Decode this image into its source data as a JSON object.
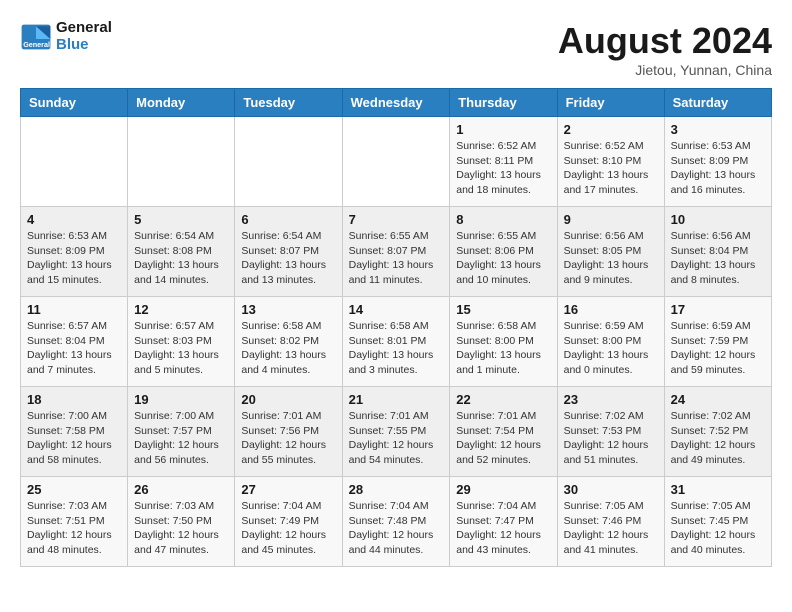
{
  "logo": {
    "line1": "General",
    "line2": "Blue"
  },
  "title": "August 2024",
  "subtitle": "Jietou, Yunnan, China",
  "weekdays": [
    "Sunday",
    "Monday",
    "Tuesday",
    "Wednesday",
    "Thursday",
    "Friday",
    "Saturday"
  ],
  "weeks": [
    [
      {
        "day": "",
        "info": ""
      },
      {
        "day": "",
        "info": ""
      },
      {
        "day": "",
        "info": ""
      },
      {
        "day": "",
        "info": ""
      },
      {
        "day": "1",
        "info": "Sunrise: 6:52 AM\nSunset: 8:11 PM\nDaylight: 13 hours\nand 18 minutes."
      },
      {
        "day": "2",
        "info": "Sunrise: 6:52 AM\nSunset: 8:10 PM\nDaylight: 13 hours\nand 17 minutes."
      },
      {
        "day": "3",
        "info": "Sunrise: 6:53 AM\nSunset: 8:09 PM\nDaylight: 13 hours\nand 16 minutes."
      }
    ],
    [
      {
        "day": "4",
        "info": "Sunrise: 6:53 AM\nSunset: 8:09 PM\nDaylight: 13 hours\nand 15 minutes."
      },
      {
        "day": "5",
        "info": "Sunrise: 6:54 AM\nSunset: 8:08 PM\nDaylight: 13 hours\nand 14 minutes."
      },
      {
        "day": "6",
        "info": "Sunrise: 6:54 AM\nSunset: 8:07 PM\nDaylight: 13 hours\nand 13 minutes."
      },
      {
        "day": "7",
        "info": "Sunrise: 6:55 AM\nSunset: 8:07 PM\nDaylight: 13 hours\nand 11 minutes."
      },
      {
        "day": "8",
        "info": "Sunrise: 6:55 AM\nSunset: 8:06 PM\nDaylight: 13 hours\nand 10 minutes."
      },
      {
        "day": "9",
        "info": "Sunrise: 6:56 AM\nSunset: 8:05 PM\nDaylight: 13 hours\nand 9 minutes."
      },
      {
        "day": "10",
        "info": "Sunrise: 6:56 AM\nSunset: 8:04 PM\nDaylight: 13 hours\nand 8 minutes."
      }
    ],
    [
      {
        "day": "11",
        "info": "Sunrise: 6:57 AM\nSunset: 8:04 PM\nDaylight: 13 hours\nand 7 minutes."
      },
      {
        "day": "12",
        "info": "Sunrise: 6:57 AM\nSunset: 8:03 PM\nDaylight: 13 hours\nand 5 minutes."
      },
      {
        "day": "13",
        "info": "Sunrise: 6:58 AM\nSunset: 8:02 PM\nDaylight: 13 hours\nand 4 minutes."
      },
      {
        "day": "14",
        "info": "Sunrise: 6:58 AM\nSunset: 8:01 PM\nDaylight: 13 hours\nand 3 minutes."
      },
      {
        "day": "15",
        "info": "Sunrise: 6:58 AM\nSunset: 8:00 PM\nDaylight: 13 hours\nand 1 minute."
      },
      {
        "day": "16",
        "info": "Sunrise: 6:59 AM\nSunset: 8:00 PM\nDaylight: 13 hours\nand 0 minutes."
      },
      {
        "day": "17",
        "info": "Sunrise: 6:59 AM\nSunset: 7:59 PM\nDaylight: 12 hours\nand 59 minutes."
      }
    ],
    [
      {
        "day": "18",
        "info": "Sunrise: 7:00 AM\nSunset: 7:58 PM\nDaylight: 12 hours\nand 58 minutes."
      },
      {
        "day": "19",
        "info": "Sunrise: 7:00 AM\nSunset: 7:57 PM\nDaylight: 12 hours\nand 56 minutes."
      },
      {
        "day": "20",
        "info": "Sunrise: 7:01 AM\nSunset: 7:56 PM\nDaylight: 12 hours\nand 55 minutes."
      },
      {
        "day": "21",
        "info": "Sunrise: 7:01 AM\nSunset: 7:55 PM\nDaylight: 12 hours\nand 54 minutes."
      },
      {
        "day": "22",
        "info": "Sunrise: 7:01 AM\nSunset: 7:54 PM\nDaylight: 12 hours\nand 52 minutes."
      },
      {
        "day": "23",
        "info": "Sunrise: 7:02 AM\nSunset: 7:53 PM\nDaylight: 12 hours\nand 51 minutes."
      },
      {
        "day": "24",
        "info": "Sunrise: 7:02 AM\nSunset: 7:52 PM\nDaylight: 12 hours\nand 49 minutes."
      }
    ],
    [
      {
        "day": "25",
        "info": "Sunrise: 7:03 AM\nSunset: 7:51 PM\nDaylight: 12 hours\nand 48 minutes."
      },
      {
        "day": "26",
        "info": "Sunrise: 7:03 AM\nSunset: 7:50 PM\nDaylight: 12 hours\nand 47 minutes."
      },
      {
        "day": "27",
        "info": "Sunrise: 7:04 AM\nSunset: 7:49 PM\nDaylight: 12 hours\nand 45 minutes."
      },
      {
        "day": "28",
        "info": "Sunrise: 7:04 AM\nSunset: 7:48 PM\nDaylight: 12 hours\nand 44 minutes."
      },
      {
        "day": "29",
        "info": "Sunrise: 7:04 AM\nSunset: 7:47 PM\nDaylight: 12 hours\nand 43 minutes."
      },
      {
        "day": "30",
        "info": "Sunrise: 7:05 AM\nSunset: 7:46 PM\nDaylight: 12 hours\nand 41 minutes."
      },
      {
        "day": "31",
        "info": "Sunrise: 7:05 AM\nSunset: 7:45 PM\nDaylight: 12 hours\nand 40 minutes."
      }
    ]
  ]
}
